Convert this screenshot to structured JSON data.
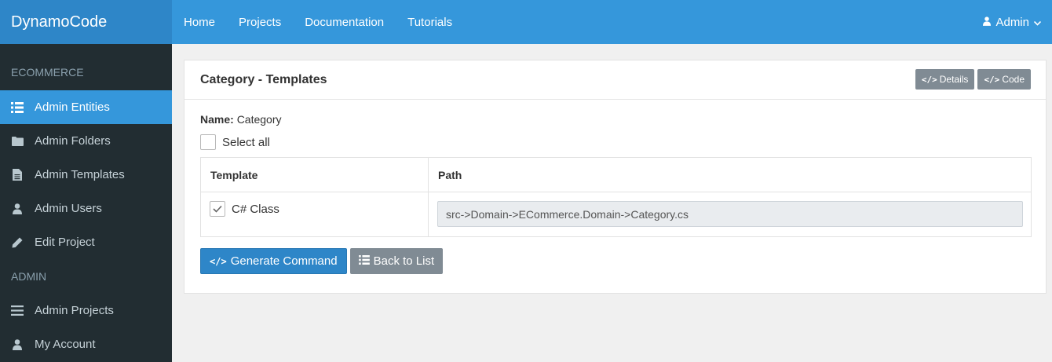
{
  "app": {
    "brand": "DynamoCode"
  },
  "navbar": {
    "links": [
      "Home",
      "Projects",
      "Documentation",
      "Tutorials"
    ],
    "user": "Admin"
  },
  "sidebar": {
    "sections": [
      {
        "header": "ECOMMERCE",
        "items": [
          {
            "label": "Admin Entities",
            "icon": "list-icon",
            "active": true
          },
          {
            "label": "Admin Folders",
            "icon": "folder-icon"
          },
          {
            "label": "Admin Templates",
            "icon": "file-icon"
          },
          {
            "label": "Admin Users",
            "icon": "user-icon"
          },
          {
            "label": "Edit Project",
            "icon": "pencil-icon"
          }
        ]
      },
      {
        "header": "ADMIN",
        "items": [
          {
            "label": "Admin Projects",
            "icon": "bars-icon"
          },
          {
            "label": "My Account",
            "icon": "user-icon"
          }
        ]
      }
    ]
  },
  "panel": {
    "title": "Category - Templates",
    "details_label": "Details",
    "code_label": "Code",
    "name_label": "Name:",
    "name_value": "Category",
    "select_all_label": "Select all",
    "select_all_checked": false,
    "columns": [
      "Template",
      "Path"
    ],
    "rows": [
      {
        "template": "C# Class",
        "checked": true,
        "path": "src->Domain->ECommerce.Domain->Category.cs"
      }
    ],
    "generate_label": "Generate Command",
    "back_label": "Back to List"
  },
  "colors": {
    "brand": "#2e86c8",
    "navbar": "#3597db",
    "sidebar": "#222d32",
    "active_item": "#3597db",
    "secondary_button": "#808b94"
  }
}
